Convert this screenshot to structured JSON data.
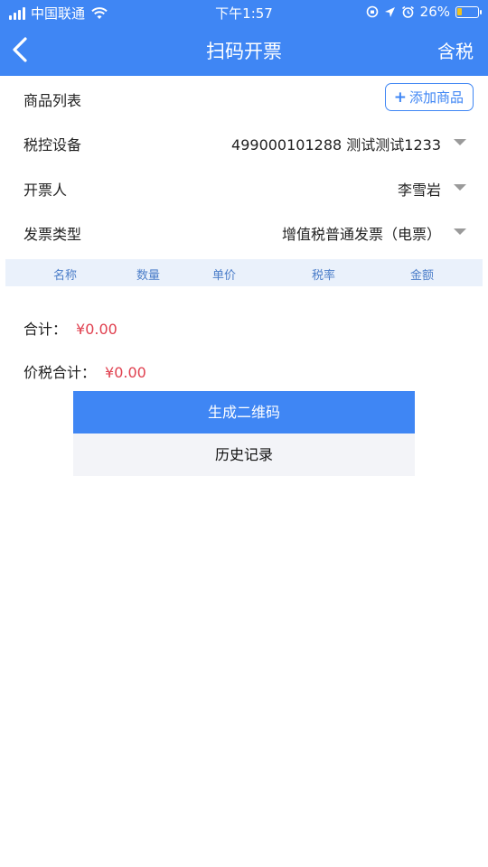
{
  "status_bar": {
    "carrier": "中国联通",
    "time": "下午1:57",
    "battery": "26%",
    "battery_level": 0.26
  },
  "nav": {
    "title": "扫码开票",
    "right_action": "含税"
  },
  "form": {
    "goods_list_label": "商品列表",
    "add_goods_button": "添加商品",
    "tax_device_label": "税控设备",
    "tax_device_value": "499000101288 测试测试1233",
    "drawer_label": "开票人",
    "drawer_value": "李雪岩",
    "invoice_type_label": "发票类型",
    "invoice_type_value": "增值税普通发票（电票）"
  },
  "table": {
    "columns": [
      "名称",
      "数量",
      "单价",
      "税率",
      "金额"
    ]
  },
  "totals": {
    "total_label": "合计：",
    "total_value": "¥0.00",
    "tax_total_label": "价税合计：",
    "tax_total_value": "¥0.00"
  },
  "actions": {
    "generate_qr": "生成二维码",
    "history": "历史记录"
  },
  "colors": {
    "primary": "#3f86f4",
    "amount": "#e0404f",
    "table_header_bg": "#eaf1fb"
  }
}
